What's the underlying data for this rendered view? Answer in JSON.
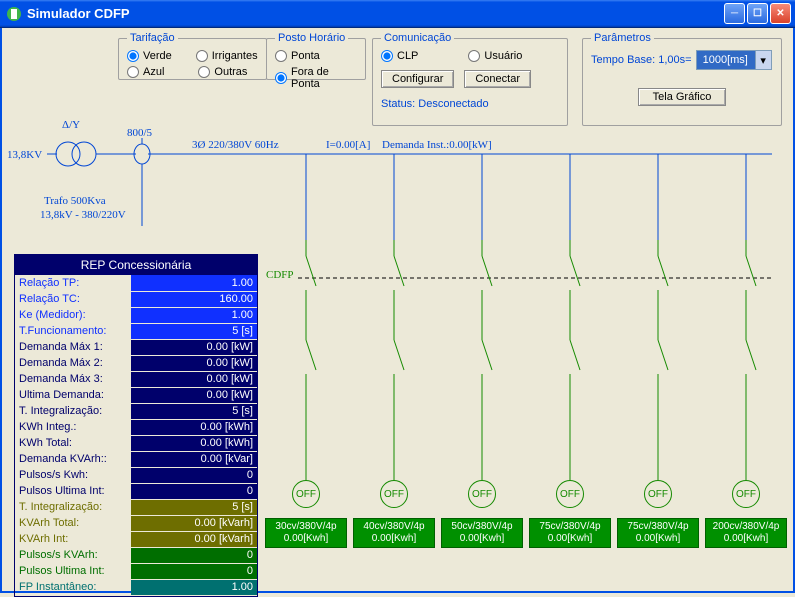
{
  "window": {
    "title": "Simulador CDFP"
  },
  "tarifacao": {
    "legend": "Tarifação",
    "opt_verde": "Verde",
    "opt_irrigantes": "Irrigantes",
    "opt_azul": "Azul",
    "opt_outras": "Outras"
  },
  "posto": {
    "legend": "Posto Horário",
    "opt_ponta": "Ponta",
    "opt_fora": "Fora de Ponta"
  },
  "comunicacao": {
    "legend": "Comunicação",
    "opt_clp": "CLP",
    "opt_usuario": "Usuário",
    "btn_configurar": "Configurar",
    "btn_conectar": "Conectar",
    "status_label": "Status: Desconectado"
  },
  "parametros": {
    "legend": "Parâmetros",
    "tempo_label": "Tempo Base: 1,00s=",
    "tempo_value": "1000[ms]",
    "btn_tela": "Tela Gráfico"
  },
  "diagram": {
    "delta_y": "Δ/Y",
    "ratio": "800/5",
    "voltage_in": "13,8KV",
    "info_3ph": "3Ø 220/380V 60Hz",
    "current": "I=0.00[A]",
    "demanda": "Demanda Inst.:0.00[kW]",
    "trafo1": "Trafo 500Kva",
    "trafo2": "13,8kV - 380/220V",
    "cdfp": "CDFP"
  },
  "rep": {
    "title": "REP Concessionária",
    "rows": [
      {
        "label": "Relação TP:",
        "value": "1.00",
        "lc": "c-blue",
        "vc": "b-blue"
      },
      {
        "label": "Relação TC:",
        "value": "160.00",
        "lc": "c-blue",
        "vc": "b-blue"
      },
      {
        "label": "Ke (Medidor):",
        "value": "1.00",
        "lc": "c-blue",
        "vc": "b-blue"
      },
      {
        "label": "T.Funcionamento:",
        "value": "5 [s]",
        "lc": "c-blue",
        "vc": "b-blue"
      },
      {
        "label": "Demanda Máx 1:",
        "value": "0.00 [kW]",
        "lc": "c-navy",
        "vc": "b-navy"
      },
      {
        "label": "Demanda Máx 2:",
        "value": "0.00 [kW]",
        "lc": "c-navy",
        "vc": "b-navy"
      },
      {
        "label": "Demanda Máx 3:",
        "value": "0.00 [kW]",
        "lc": "c-navy",
        "vc": "b-navy"
      },
      {
        "label": "Ultima Demanda:",
        "value": "0.00 [kW]",
        "lc": "c-navy",
        "vc": "b-navy"
      },
      {
        "label": "T. Integralização:",
        "value": "5 [s]",
        "lc": "c-navy",
        "vc": "b-navy"
      },
      {
        "label": "KWh Integ.:",
        "value": "0.00 [kWh]",
        "lc": "c-navy",
        "vc": "b-navy"
      },
      {
        "label": "KWh Total:",
        "value": "0.00 [kWh]",
        "lc": "c-navy",
        "vc": "b-navy"
      },
      {
        "label": "Demanda KVArh::",
        "value": "0.00 [kVar]",
        "lc": "c-navy",
        "vc": "b-navy"
      },
      {
        "label": "Pulsos/s Kwh:",
        "value": "0",
        "lc": "c-navy",
        "vc": "b-navy"
      },
      {
        "label": "Pulsos Ultima Int:",
        "value": "0",
        "lc": "c-navy",
        "vc": "b-navy"
      },
      {
        "label": "T. Integralização:",
        "value": "5 [s]",
        "lc": "c-olive",
        "vc": "b-olive"
      },
      {
        "label": "KVArh Total:",
        "value": "0.00 [kVarh]",
        "lc": "c-olive",
        "vc": "b-olive"
      },
      {
        "label": "KVArh Int:",
        "value": "0.00 [kVarh]",
        "lc": "c-olive",
        "vc": "b-olive"
      },
      {
        "label": "Pulsos/s KVArh:",
        "value": "0",
        "lc": "c-green",
        "vc": "b-green"
      },
      {
        "label": "Pulsos Ultima Int:",
        "value": "0",
        "lc": "c-green",
        "vc": "b-green"
      },
      {
        "label": "FP Instantâneo:",
        "value": "1.00",
        "lc": "c-teal",
        "vc": "b-teal"
      }
    ]
  },
  "loads": [
    {
      "off": "OFF",
      "l1": "30cv/380V/4p",
      "l2": "0.00[Kwh]"
    },
    {
      "off": "OFF",
      "l1": "40cv/380V/4p",
      "l2": "0.00[Kwh]"
    },
    {
      "off": "OFF",
      "l1": "50cv/380V/4p",
      "l2": "0.00[Kwh]"
    },
    {
      "off": "OFF",
      "l1": "75cv/380V/4p",
      "l2": "0.00[Kwh]"
    },
    {
      "off": "OFF",
      "l1": "75cv/380V/4p",
      "l2": "0.00[Kwh]"
    },
    {
      "off": "OFF",
      "l1": "200cv/380V/4p",
      "l2": "0.00[Kwh]"
    }
  ]
}
